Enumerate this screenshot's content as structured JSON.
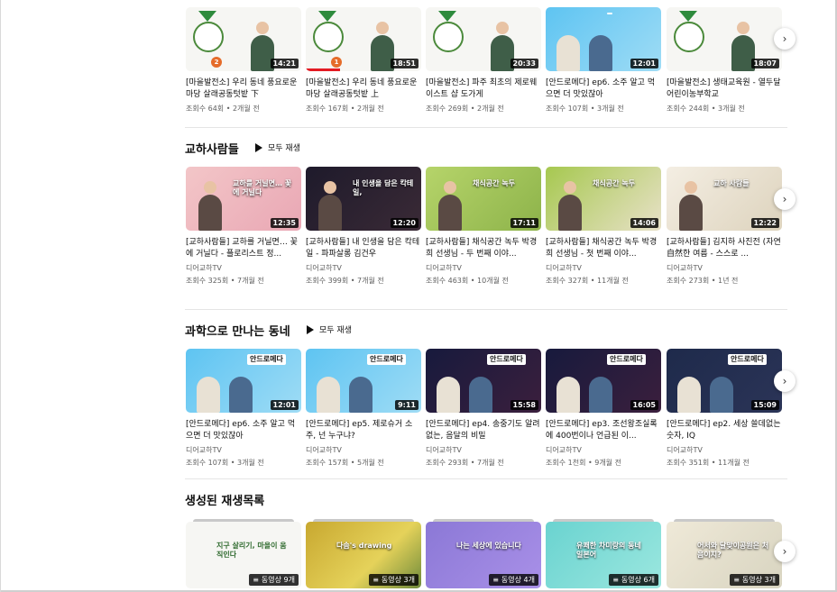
{
  "sections": {
    "top": {
      "videos": [
        {
          "title": "[마을발전소] 우리 동네 풍요로운 마당 살래공동텃밭 下",
          "meta": "조회수 64회 • 2개월 전",
          "duration": "14:21"
        },
        {
          "title": "[마을발전소] 우리 동네 풍요로운 마당 살래공동텃밭 上",
          "meta": "조회수 167회 • 2개월 전",
          "duration": "18:51"
        },
        {
          "title": "[마을발전소] 파주 최초의 제로웨이스트 샵 도가게",
          "meta": "조회수 269회 • 2개월 전",
          "duration": "20:33"
        },
        {
          "title": "[안드로메다] ep6. 소주 알고 먹으면 더 맛있잖아",
          "meta": "조회수 107회 • 3개월 전",
          "duration": "12:01"
        },
        {
          "title": "[마을발전소] 생태교육원 - 열두달어린이농부학교",
          "meta": "조회수 244회 • 3개월 전",
          "duration": "18:07"
        }
      ]
    },
    "gyoha": {
      "title": "교하사람들",
      "play_all": "모두 재생",
      "videos": [
        {
          "title": "[교하사람들] 교하를 거닐면… 꽃에 거닐다 - 플로리스트 정...",
          "channel": "디어교하TV",
          "meta": "조회수 325회 • 7개월 전",
          "duration": "12:35",
          "thumb_text": "교하를 거닐면… 꽃에 거닐다"
        },
        {
          "title": "[교하사람들] 내 인생을 담은 칵테일 - 파파살롱 김건우",
          "channel": "디어교하TV",
          "meta": "조회수 399회 • 7개월 전",
          "duration": "12:20",
          "thumb_text": "내 인생을 담은 칵테일,"
        },
        {
          "title": "[교하사람들] 채식공간 녹두 박경희 선생님 - 두 번째 이야...",
          "channel": "디어교하TV",
          "meta": "조회수 463회 • 10개월 전",
          "duration": "17:11",
          "thumb_text": "채식공간 녹두"
        },
        {
          "title": "[교하사람들] 채식공간 녹두 박경희 선생님 - 첫 번째 이야...",
          "channel": "디어교하TV",
          "meta": "조회수 327회 • 11개월 전",
          "duration": "14:06",
          "thumb_text": "채식공간 녹두"
        },
        {
          "title": "[교하사람들] 김지하 사진전 (자연自然한 여름 - 스스로 ...",
          "channel": "디어교하TV",
          "meta": "조회수 273회 • 1년 전",
          "duration": "12:22",
          "thumb_text": "교하 사람들"
        }
      ]
    },
    "science": {
      "title": "과학으로 만나는 동네",
      "play_all": "모두 재생",
      "videos": [
        {
          "title": "[안드로메다] ep6. 소주 알고 먹으면 더 맛있잖아",
          "channel": "디어교하TV",
          "meta": "조회수 107회 • 3개월 전",
          "duration": "12:01",
          "thumb_text": "안드로메다"
        },
        {
          "title": "[안드로메다] ep5. 제로슈거 소주, 넌 누구냐?",
          "channel": "디어교하TV",
          "meta": "조회수 157회 • 5개월 전",
          "duration": "9:11",
          "thumb_text": "안드로메다"
        },
        {
          "title": "[안드로메다] ep4. 송중기도 알려 없는, 음달의 비밀",
          "channel": "디어교하TV",
          "meta": "조회수 293회 • 7개월 전",
          "duration": "15:58",
          "thumb_text": "안드로메다"
        },
        {
          "title": "[안드로메다] ep3. 조선왕조실록에 400번이나 언급된 이...",
          "channel": "디어교하TV",
          "meta": "조회수 1천회 • 9개월 전",
          "duration": "16:05",
          "thumb_text": "안드로메다"
        },
        {
          "title": "[안드로메다] ep2. 세상 쓸데없는 숫자, IQ",
          "channel": "디어교하TV",
          "meta": "조회수 351회 • 11개월 전",
          "duration": "15:09",
          "thumb_text": "안드로메다"
        }
      ]
    },
    "playlists": {
      "title": "생성된 재생목록",
      "items": [
        {
          "count": "동영상 9개",
          "thumb_text": "지구 살리기, 마을이 움직인다"
        },
        {
          "count": "동영상 3개",
          "thumb_text": "다솜's drawing"
        },
        {
          "count": "동영상 4개",
          "thumb_text": "나는 세상에 있습니다"
        },
        {
          "count": "동영상 6개",
          "thumb_text": "유쾌한 차미랑의 동네 일본어"
        },
        {
          "count": "동영상 3개",
          "thumb_text": "어서와 달맞이공원은 처음이지?"
        }
      ]
    }
  },
  "icons": {
    "next": "chevron-right-icon",
    "play": "play-icon",
    "playlist": "playlist-icon"
  }
}
